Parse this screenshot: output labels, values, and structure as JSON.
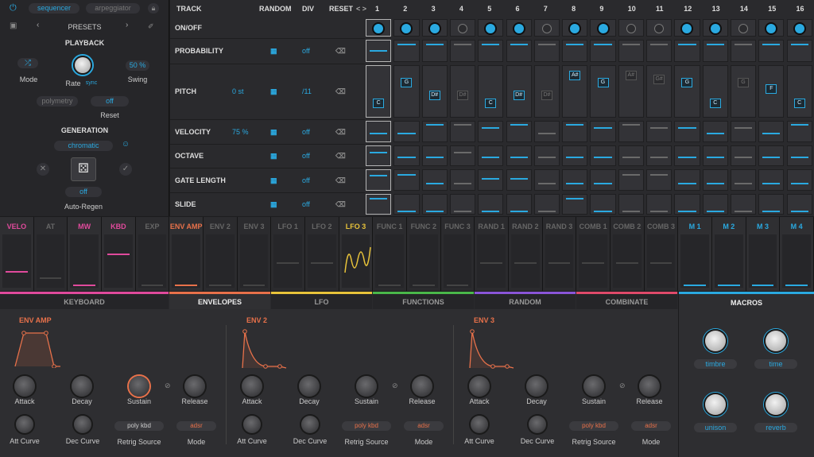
{
  "app": {
    "mode_tabs": {
      "sequencer": "sequencer",
      "arpeggiator": "arpeggiator"
    },
    "presets": "PRESETS",
    "playback": {
      "title": "PLAYBACK",
      "mode": "Mode",
      "rate": "Rate",
      "sync": "sync",
      "swing": "Swing",
      "swing_value": "50 %"
    },
    "polymetry": {
      "label": "polymetry",
      "value": "off",
      "reset": "Reset"
    },
    "generation": {
      "title": "GENERATION",
      "scale": "chromatic",
      "autoregen_value": "off",
      "autoregen": "Auto-Regen"
    }
  },
  "sequencer": {
    "headers": {
      "track": "TRACK",
      "random": "RANDOM",
      "div": "DIV",
      "reset": "RESET",
      "nav": "< >"
    },
    "steps": [
      "1",
      "2",
      "3",
      "4",
      "5",
      "6",
      "7",
      "8",
      "9",
      "10",
      "11",
      "12",
      "13",
      "14",
      "15",
      "16"
    ],
    "rows": [
      {
        "name": "ON/OFF",
        "value": "",
        "div": ""
      },
      {
        "name": "PROBABILITY",
        "value": "",
        "div": "off"
      },
      {
        "name": "PITCH",
        "value": "0 st",
        "div": "/11"
      },
      {
        "name": "VELOCITY",
        "value": "75 %",
        "div": "off"
      },
      {
        "name": "OCTAVE",
        "value": "",
        "div": "off"
      },
      {
        "name": "GATE LENGTH",
        "value": "",
        "div": "off"
      },
      {
        "name": "SLIDE",
        "value": "",
        "div": "off"
      }
    ],
    "onoff": [
      1,
      1,
      1,
      0,
      1,
      1,
      0,
      1,
      1,
      0,
      0,
      1,
      1,
      0,
      1,
      1
    ],
    "probability": [
      0.5,
      0.85,
      0.85,
      0.85,
      0.85,
      0.85,
      0.85,
      0.85,
      0.85,
      0.85,
      0.85,
      0.85,
      0.85,
      0.85,
      0.85,
      0.85
    ],
    "pitch_notes": [
      "C",
      "G",
      "D#",
      "D#",
      "C",
      "D#",
      "D#",
      "A#",
      "G",
      "A#",
      "G#",
      "G",
      "C",
      "G",
      "F",
      "C"
    ],
    "pitch_active": [
      1,
      1,
      1,
      0,
      1,
      1,
      0,
      1,
      1,
      0,
      0,
      1,
      1,
      0,
      1,
      1
    ],
    "pitch_level": [
      0.22,
      0.72,
      0.4,
      0.4,
      0.22,
      0.4,
      0.4,
      0.88,
      0.72,
      0.88,
      0.78,
      0.72,
      0.22,
      0.72,
      0.55,
      0.22
    ],
    "velocity": [
      0.4,
      0.4,
      0.88,
      0.88,
      0.7,
      0.88,
      0.4,
      0.88,
      0.7,
      0.88,
      0.7,
      0.7,
      0.4,
      0.7,
      0.4,
      0.88
    ],
    "octave": [
      0.7,
      0.4,
      0.4,
      0.7,
      0.4,
      0.4,
      0.4,
      0.4,
      0.4,
      0.4,
      0.4,
      0.4,
      0.4,
      0.4,
      0.4,
      0.4
    ],
    "gatelen": [
      0.75,
      0.8,
      0.3,
      0.3,
      0.55,
      0.55,
      0.3,
      0.3,
      0.3,
      0.8,
      0.8,
      0.3,
      0.3,
      0.3,
      0.3,
      0.3
    ],
    "slide": [
      0.8,
      0.1,
      0.1,
      0.1,
      0.1,
      0.1,
      0.1,
      0.8,
      0.1,
      0.1,
      0.1,
      0.1,
      0.1,
      0.1,
      0.1,
      0.1
    ]
  },
  "mod": {
    "sources": [
      {
        "name": "VELO",
        "color": "#e04a9c",
        "active": true,
        "level": 0.72
      },
      {
        "name": "AT",
        "color": "#666666",
        "active": false,
        "level": 0.8
      },
      {
        "name": "MW",
        "color": "#e04a9c",
        "active": true,
        "level": 0.95
      },
      {
        "name": "KBD",
        "color": "#e04a9c",
        "active": true,
        "level": 0.1
      },
      {
        "name": "EXP",
        "color": "#666666",
        "active": false,
        "level": 0.95
      },
      {
        "name": "ENV AMP",
        "color": "#e8714a",
        "active": true,
        "level": 0.95
      },
      {
        "name": "ENV 2",
        "color": "#666666",
        "active": false,
        "level": 0.95
      },
      {
        "name": "ENV 3",
        "color": "#666666",
        "active": false,
        "level": 0.95
      },
      {
        "name": "LFO 1",
        "color": "#666666",
        "active": false,
        "level": 0.5
      },
      {
        "name": "LFO 2",
        "color": "#666666",
        "active": false,
        "level": 0.5
      },
      {
        "name": "LFO 3",
        "color": "#e8c33a",
        "active": true,
        "level": 0.5
      },
      {
        "name": "FUNC 1",
        "color": "#666666",
        "active": false,
        "level": 0.95
      },
      {
        "name": "FUNC 2",
        "color": "#666666",
        "active": false,
        "level": 0.95
      },
      {
        "name": "FUNC 3",
        "color": "#666666",
        "active": false,
        "level": 0.95
      },
      {
        "name": "RAND 1",
        "color": "#666666",
        "active": false,
        "level": 0.5
      },
      {
        "name": "RAND 2",
        "color": "#666666",
        "active": false,
        "level": 0.5
      },
      {
        "name": "RAND 3",
        "color": "#666666",
        "active": false,
        "level": 0.5
      },
      {
        "name": "COMB 1",
        "color": "#666666",
        "active": false,
        "level": 0.5
      },
      {
        "name": "COMB 2",
        "color": "#666666",
        "active": false,
        "level": 0.5
      },
      {
        "name": "COMB 3",
        "color": "#666666",
        "active": false,
        "level": 0.5
      },
      {
        "name": "M 1",
        "color": "#2aa9e0",
        "active": true,
        "level": 0.95
      },
      {
        "name": "M 2",
        "color": "#2aa9e0",
        "active": true,
        "level": 0.95
      },
      {
        "name": "M 3",
        "color": "#2aa9e0",
        "active": true,
        "level": 0.95
      },
      {
        "name": "M 4",
        "color": "#2aa9e0",
        "active": true,
        "level": 0.95
      }
    ]
  },
  "tabs": [
    {
      "label": "KEYBOARD",
      "color": "#e04a9c",
      "active": false
    },
    {
      "label": "ENVELOPES",
      "color": "#e8714a",
      "active": true
    },
    {
      "label": "LFO",
      "color": "#e8c33a",
      "active": false
    },
    {
      "label": "FUNCTIONS",
      "color": "#4ab84a",
      "active": false
    },
    {
      "label": "RANDOM",
      "color": "#8a55d8",
      "active": false
    },
    {
      "label": "COMBINATE",
      "color": "#e04a6a",
      "active": false
    }
  ],
  "envelopes": [
    {
      "title": "ENV AMP",
      "attack": "Attack",
      "decay": "Decay",
      "sustain": "Sustain",
      "release": "Release",
      "att_curve": "Att Curve",
      "dec_curve": "Dec Curve",
      "retrig_value": "poly kbd",
      "retrig": "Retrig Source",
      "mode_value": "adsr",
      "mode": "Mode"
    },
    {
      "title": "ENV 2",
      "attack": "Attack",
      "decay": "Decay",
      "sustain": "Sustain",
      "release": "Release",
      "att_curve": "Att Curve",
      "dec_curve": "Dec Curve",
      "retrig_value": "poly kbd",
      "retrig": "Retrig Source",
      "mode_value": "adsr",
      "mode": "Mode"
    },
    {
      "title": "ENV 3",
      "attack": "Attack",
      "decay": "Decay",
      "sustain": "Sustain",
      "release": "Release",
      "att_curve": "Att Curve",
      "dec_curve": "Dec Curve",
      "retrig_value": "poly kbd",
      "retrig": "Retrig Source",
      "mode_value": "adsr",
      "mode": "Mode"
    }
  ],
  "macros": {
    "title": "MACROS",
    "items": [
      "timbre",
      "time",
      "unison",
      "reverb"
    ]
  },
  "colors": {
    "accent": "#2aa9e0",
    "env": "#e8714a"
  }
}
